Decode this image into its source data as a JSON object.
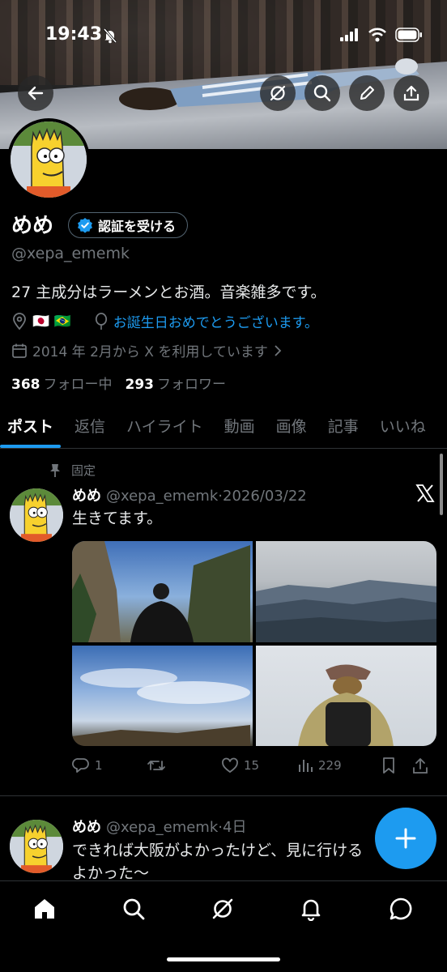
{
  "status_bar": {
    "time": "19:43"
  },
  "profile": {
    "name": "めめ",
    "verify_label": "認証を受ける",
    "handle": "@xepa_ememk",
    "bio": "27 主成分はラーメンとお酒。音楽雑多です。",
    "location_flags": "🇯🇵 🇧🇷",
    "birthday": "お誕生日おめでとうございます。",
    "joined": "2014 年 2月から X を利用しています",
    "following_count": "368",
    "following_label": "フォロー中",
    "followers_count": "293",
    "followers_label": "フォロワー"
  },
  "tabs": [
    "ポスト",
    "返信",
    "ハイライト",
    "動画",
    "画像",
    "記事",
    "いいね"
  ],
  "active_tab": 0,
  "posts": [
    {
      "pinned_label": "固定",
      "name": "めめ",
      "handle": "@xepa_ememk",
      "sep": "·",
      "time": "2026/03/22",
      "text": "生きてます。",
      "replies": "1",
      "reposts": "",
      "likes": "15",
      "views": "229"
    },
    {
      "name": "めめ",
      "handle": "@xepa_ememk",
      "sep": "·",
      "time": "4日",
      "text_line1": "できれば大阪がよかったけど、見に行ける",
      "text_line2": "よかった〜"
    }
  ],
  "icons": {
    "back": "arrow-left-icon",
    "grok": "grok-icon",
    "search": "search-icon",
    "edit": "pencil-icon",
    "share": "share-icon",
    "home": "home-icon",
    "notifications": "bell-icon",
    "messages": "message-icon",
    "compose": "plus-icon"
  },
  "colors": {
    "accent": "#1d9bf0",
    "muted": "#71767b",
    "background": "#000000"
  }
}
